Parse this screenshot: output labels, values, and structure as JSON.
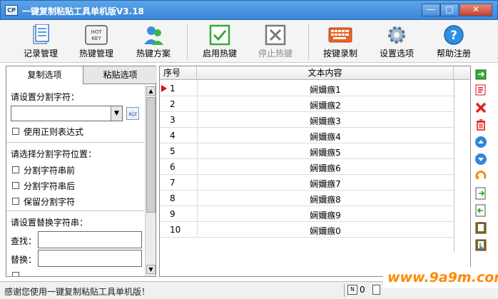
{
  "window": {
    "icon_text": "CP",
    "title": "一键复制粘贴工具单机版V3.18",
    "min_glyph": "—",
    "max_glyph": "□",
    "close_glyph": "✕"
  },
  "toolbar": {
    "buttons": [
      {
        "label": "记录管理",
        "icon": "records-icon",
        "enabled": true
      },
      {
        "label": "热键管理",
        "icon": "hotkey-keyboard-icon",
        "enabled": true
      },
      {
        "label": "热键方案",
        "icon": "users-scheme-icon",
        "enabled": true
      },
      {
        "label": "启用热键",
        "icon": "check-box-icon",
        "enabled": true
      },
      {
        "label": "停止热键",
        "icon": "x-box-icon",
        "enabled": false
      },
      {
        "label": "按键录制",
        "icon": "keyboard-record-icon",
        "enabled": true
      },
      {
        "label": "设置选项",
        "icon": "gear-icon",
        "enabled": true
      },
      {
        "label": "帮助注册",
        "icon": "help-icon",
        "enabled": true
      }
    ],
    "hotkey_icon_text": "HOT KEY"
  },
  "left_panel": {
    "tabs": [
      "复制选项",
      "粘贴选项"
    ],
    "active_tab": 0,
    "separator_label": "请设置分割字符：",
    "separator_value": "",
    "az_icon_text": "a|z",
    "use_regex": "使用正则表达式",
    "position_label": "请选择分割字符位置：",
    "pos_before": "分割字符串前",
    "pos_after": "分割字符串后",
    "keep_separator": "保留分割字符",
    "replace_label": "请设置替换字符串：",
    "find_label": "查找：",
    "replace_with_label": "替换："
  },
  "table": {
    "columns": [
      "序号",
      "文本内容"
    ],
    "rows": [
      {
        "num": "1",
        "text": "娴嬭瘯1"
      },
      {
        "num": "2",
        "text": "娴嬭瘯2"
      },
      {
        "num": "3",
        "text": "娴嬭瘯3"
      },
      {
        "num": "4",
        "text": "娴嬭瘯4"
      },
      {
        "num": "5",
        "text": "娴嬭瘯5"
      },
      {
        "num": "6",
        "text": "娴嬭瘯6"
      },
      {
        "num": "7",
        "text": "娴嬭瘯7"
      },
      {
        "num": "8",
        "text": "娴嬭瘯8"
      },
      {
        "num": "9",
        "text": "娴嬭瘯9"
      },
      {
        "num": "10",
        "text": "娴嬭瘯0"
      }
    ],
    "selected_row": 0
  },
  "right_tools": [
    "export-icon",
    "edit-icon",
    "delete-icon",
    "trash-icon",
    "move-up-icon",
    "move-down-icon",
    "undo-icon",
    "import-icon",
    "import-alt-icon",
    "clipboard-icon",
    "clipboard-cursor-icon"
  ],
  "statusbar": {
    "message": "感谢您使用一键复制粘贴工具单机版！",
    "badge": "N",
    "count": "0"
  },
  "watermark": "www.9a9m.com",
  "colors": {
    "title_bar": "#3c86d6",
    "accent_red": "#d11111",
    "watermark": "#ff8a00"
  }
}
